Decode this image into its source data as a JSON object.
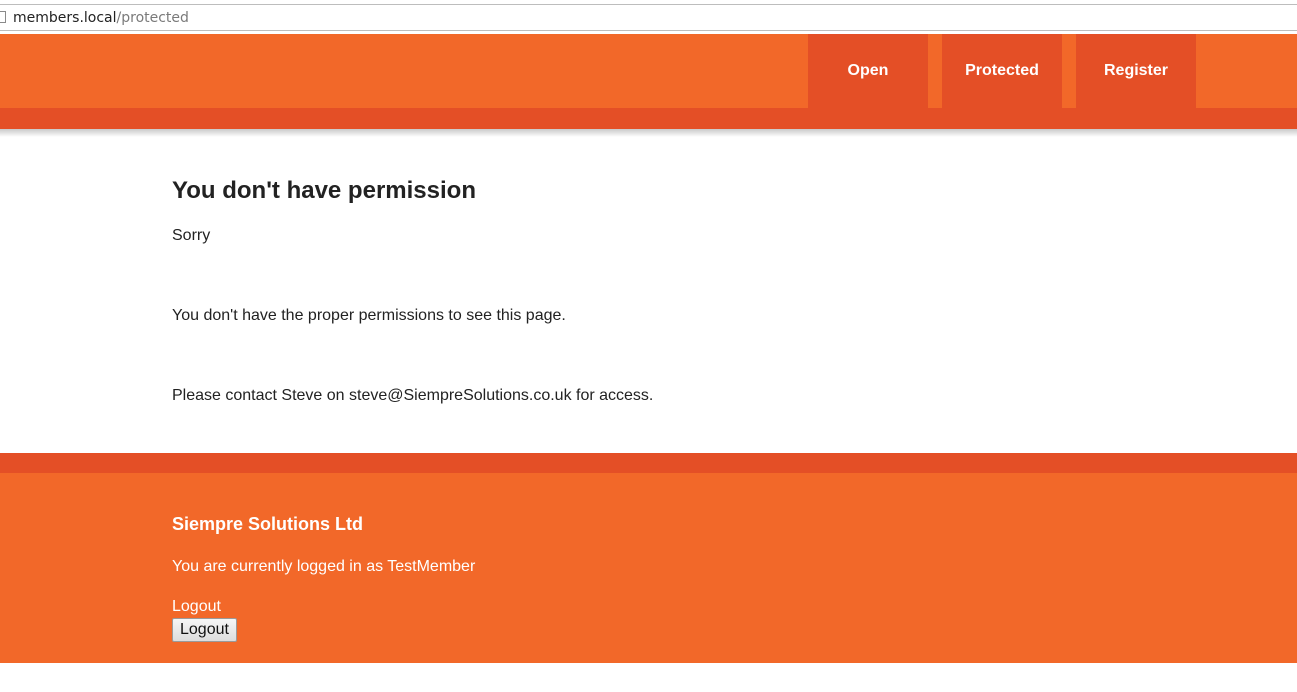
{
  "browser": {
    "url_host": "members.local",
    "url_path": "/protected",
    "page_icon": "page-icon"
  },
  "nav": {
    "items": [
      {
        "label": "Open"
      },
      {
        "label": "Protected"
      },
      {
        "label": "Register"
      }
    ]
  },
  "main": {
    "title": "You don't have permission",
    "sorry": "Sorry",
    "permission_text": "You don't have the proper permissions to see this page.",
    "contact_text": "Please contact Steve on steve@SiempreSolutions.co.uk for access."
  },
  "footer": {
    "company": "Siempre Solutions Ltd",
    "status": "You are currently logged in as TestMember",
    "logout_label": "Logout",
    "logout_button": "Logout"
  },
  "colors": {
    "primary_orange": "#f26829",
    "dark_orange": "#e44f26",
    "text": "#222222"
  }
}
